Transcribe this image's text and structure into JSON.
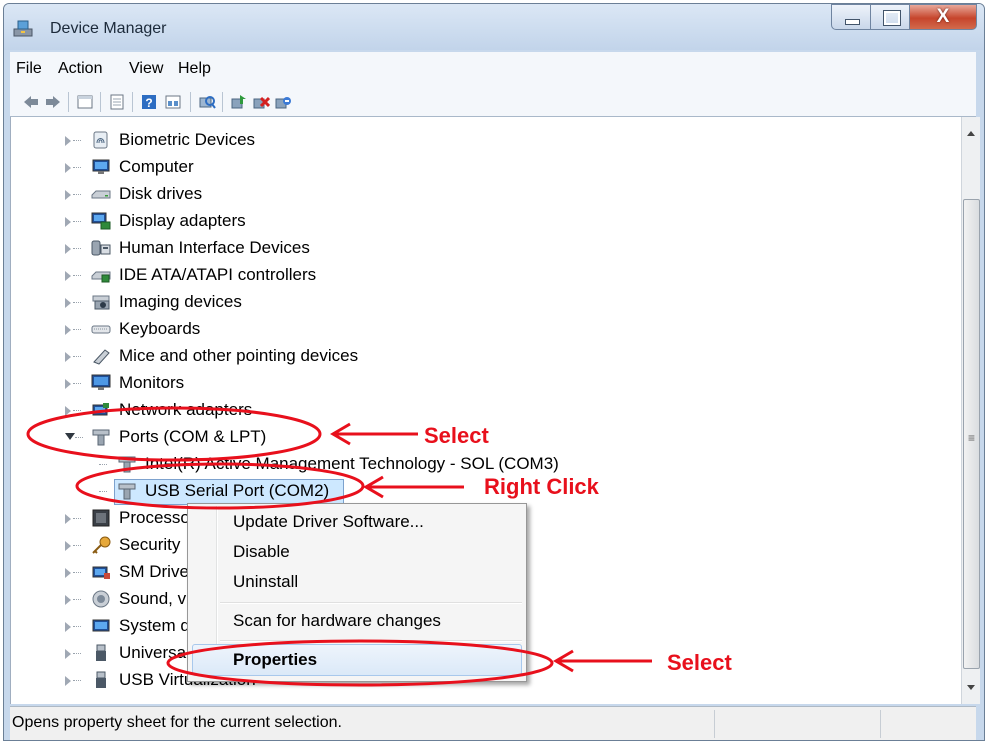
{
  "window": {
    "title": "Device Manager",
    "close_glyph": "X"
  },
  "menubar": {
    "items": [
      "File",
      "Action",
      "View",
      "Help"
    ]
  },
  "toolbar": {
    "icons": [
      "back-icon",
      "forward-icon",
      "show-hide-tree-icon",
      "properties-icon",
      "help-icon",
      "view-icon",
      "scan-hardware-icon",
      "update-driver-icon",
      "uninstall-icon",
      "disable-icon"
    ]
  },
  "tree": {
    "items": [
      {
        "label": "Biometric Devices",
        "icon": "fingerprint-icon"
      },
      {
        "label": "Computer",
        "icon": "computer-icon"
      },
      {
        "label": "Disk drives",
        "icon": "disk-drive-icon"
      },
      {
        "label": "Display adapters",
        "icon": "display-adapter-icon"
      },
      {
        "label": "Human Interface Devices",
        "icon": "hid-icon"
      },
      {
        "label": "IDE ATA/ATAPI controllers",
        "icon": "ide-controller-icon"
      },
      {
        "label": "Imaging devices",
        "icon": "camera-icon"
      },
      {
        "label": "Keyboards",
        "icon": "keyboard-icon"
      },
      {
        "label": "Mice and other pointing devices",
        "icon": "mouse-icon"
      },
      {
        "label": "Monitors",
        "icon": "monitor-icon"
      },
      {
        "label": "Network adapters",
        "icon": "network-adapter-icon"
      },
      {
        "label": "Ports (COM & LPT)",
        "icon": "port-icon",
        "expanded": true
      },
      {
        "label": "Intel(R) Active Management Technology - SOL (COM3)",
        "icon": "port-icon",
        "child": true
      },
      {
        "label": "USB Serial Port (COM2)",
        "icon": "port-icon",
        "child": true,
        "selected": true
      },
      {
        "label": "Processo",
        "icon": "processor-icon"
      },
      {
        "label": "Security",
        "icon": "security-key-icon"
      },
      {
        "label": "SM Drive",
        "icon": "sm-driver-icon"
      },
      {
        "label": "Sound, vi",
        "icon": "speaker-icon"
      },
      {
        "label": "System d",
        "icon": "system-device-icon"
      },
      {
        "label": "Universal",
        "icon": "usb-plug-icon"
      },
      {
        "label": "USB Virtualization",
        "icon": "usb-plug-icon"
      }
    ]
  },
  "context_menu": {
    "items": [
      "Update Driver Software...",
      "Disable",
      "Uninstall",
      "Scan for hardware changes",
      "Properties"
    ],
    "highlighted": "Properties"
  },
  "status": {
    "text": "Opens property sheet for the current selection."
  },
  "annotations": {
    "select_ports": "Select",
    "right_click": "Right Click",
    "select_properties": "Select"
  },
  "colors": {
    "annotation": "#e8101c",
    "title_bar": "#c2d4ea",
    "selection": "#cde8ff"
  }
}
